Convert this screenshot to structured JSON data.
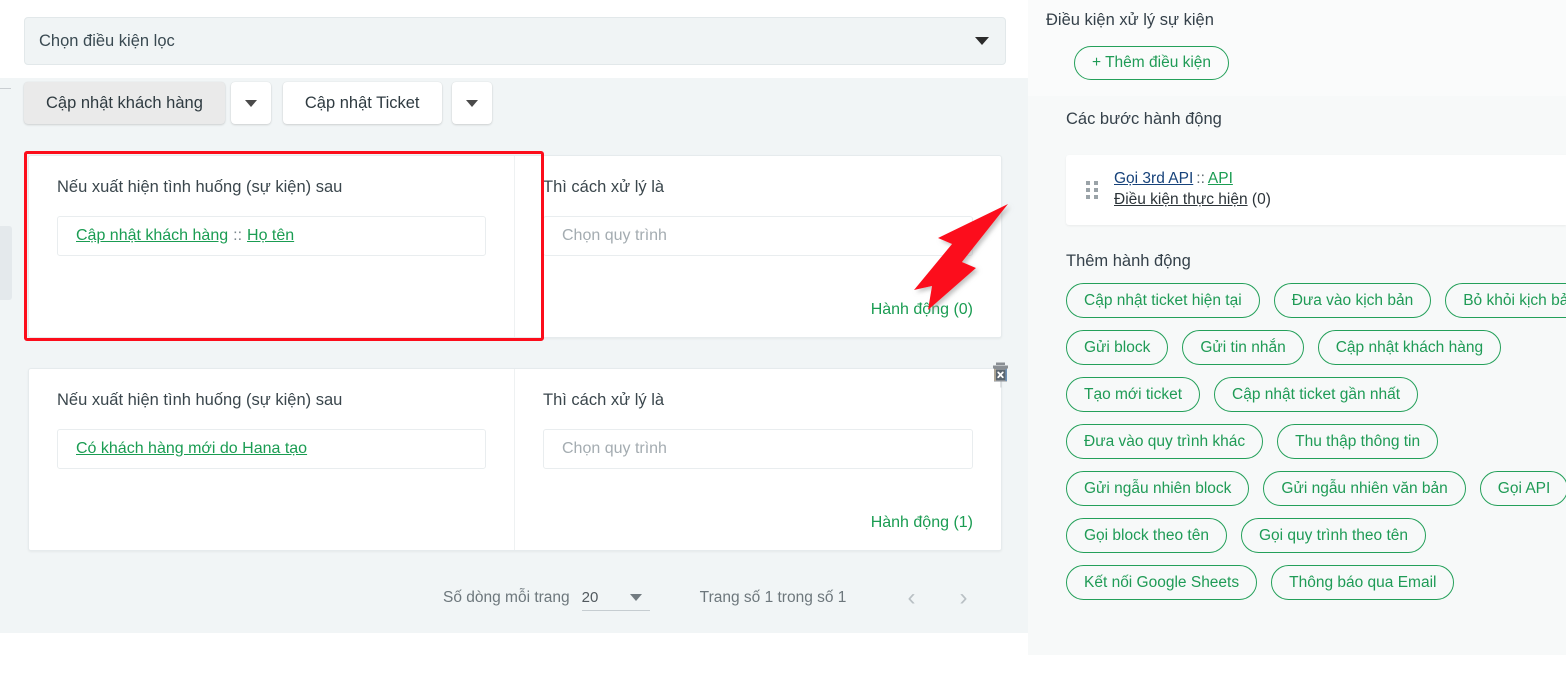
{
  "colors": {
    "green": "#1a9c52",
    "green_border": "#24a05a",
    "annotation_red": "#fc0d1b",
    "link_blue": "#16427a",
    "panel_bg": "#f1f5f6",
    "right_panel_bg": "#f7f9f9"
  },
  "main": {
    "filter": {
      "placeholder": "Chọn điều kiện lọc",
      "caret_icon": "chevron-down-icon"
    },
    "tabs": [
      {
        "label": "Cập nhật khách hàng",
        "active": true,
        "caret_icon": "chevron-down-icon"
      },
      {
        "label": "Cập nhật Ticket",
        "active": false,
        "caret_icon": "chevron-down-icon"
      }
    ],
    "cards": [
      {
        "if_title": "Nếu xuất hiện tình huống (sự kiện) sau",
        "event_chip": {
          "source": "Cập nhật khách hàng",
          "separator": "::",
          "field": "Họ tên"
        },
        "then_title": "Thì cách xử lý là",
        "process_placeholder": "Chọn quy trình",
        "action_count_label": "Hành động (0)",
        "highlighted": true,
        "has_delete": false
      },
      {
        "if_title": "Nếu xuất hiện tình huống (sự kiện) sau",
        "event_chip": {
          "source": "Có khách hàng mới do Hana tạo",
          "separator": "",
          "field": ""
        },
        "then_title": "Thì cách xử lý là",
        "process_placeholder": "Chọn quy trình",
        "action_count_label": "Hành động (1)",
        "highlighted": false,
        "has_delete": true,
        "delete_icon": "trash-icon"
      }
    ],
    "pagination": {
      "rows_label": "Số dòng mỗi trang",
      "rows_value": "20",
      "rows_caret_icon": "chevron-down-icon",
      "page_info": "Trang số 1 trong số 1",
      "prev_icon": "chevron-left-icon",
      "next_icon": "chevron-right-icon"
    }
  },
  "right": {
    "condition_section": {
      "title": "Điều kiện xử lý sự kiện",
      "add_button": "+ Thêm điều kiện"
    },
    "steps_section": {
      "title": "Các bước hành động",
      "items": [
        {
          "drag_icon": "drag-handle-icon",
          "name": "Gọi 3rd API",
          "separator": "::",
          "type": "API",
          "condition_label": "Điều kiện thực hiện",
          "condition_count": "(0)"
        }
      ]
    },
    "add_action_section": {
      "title": "Thêm hành động",
      "buttons": [
        "Cập nhật ticket hiện tại",
        "Đưa vào kịch bản",
        "Bỏ khỏi kịch bản",
        "Gửi block",
        "Gửi tin nhắn",
        "Cập nhật khách hàng",
        "Tạo mới ticket",
        "Cập nhật ticket gần nhất",
        "Đưa vào quy trình khác",
        "Thu thập thông tin",
        "Gửi ngẫu nhiên block",
        "Gửi ngẫu nhiên văn bản",
        "Gọi API",
        "Gọi block theo tên",
        "Gọi quy trình theo tên",
        "Kết nối Google Sheets",
        "Thông báo qua Email"
      ]
    }
  },
  "annotation": {
    "arrow_icon": "red-arrow-pointer",
    "points_to": "Hành động (0)"
  }
}
